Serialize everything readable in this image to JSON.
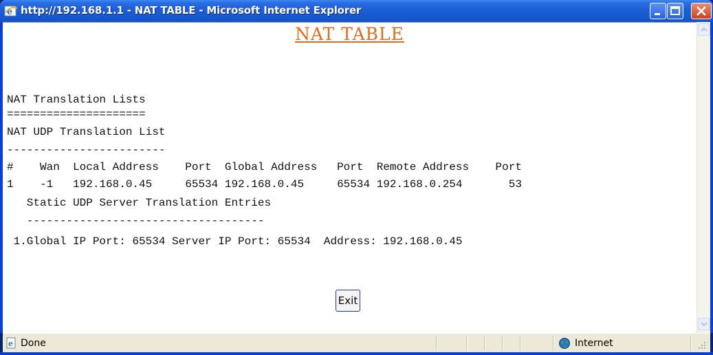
{
  "window": {
    "title": "http://192.168.1.1 - NAT TABLE - Microsoft Internet Explorer"
  },
  "page": {
    "heading": "NAT TABLE",
    "lines": [
      "NAT Translation Lists",
      "=====================",
      "NAT UDP Translation List",
      "------------------------",
      "#    Wan  Local Address    Port  Global Address   Port  Remote Address    Port",
      "1    -1   192.168.0.45     65534 192.168.0.45     65534 192.168.0.254       53",
      "   Static UDP Server Translation Entries",
      "   ------------------------------------",
      " 1.Global IP Port: 65534 Server IP Port: 65534  Address: 192.168.0.45"
    ],
    "exit_label": "Exit"
  },
  "statusbar": {
    "status": "Done",
    "zone": "Internet"
  },
  "icons": {
    "title": "ie-logo-icon",
    "status": "page-done-icon",
    "zone": "internet-globe-icon"
  },
  "colors": {
    "titlebar": "#2a6fe2",
    "heading": "#e06b1f",
    "close_button": "#cc3f1c",
    "statusbar": "#ece9d8"
  }
}
